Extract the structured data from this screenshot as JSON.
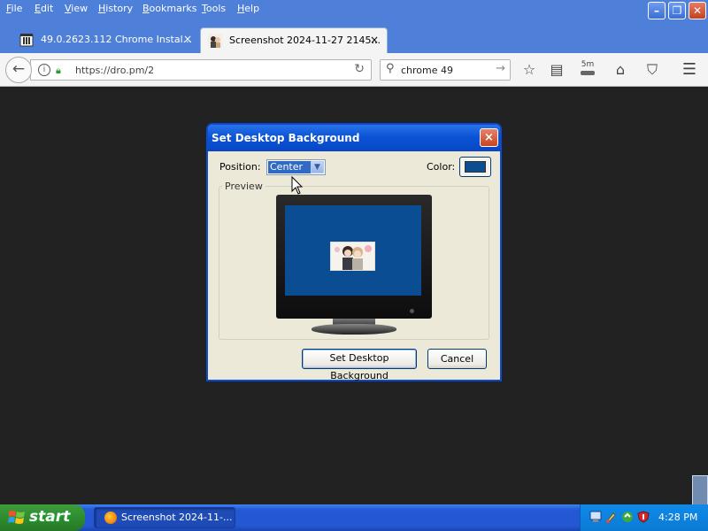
{
  "menubar": {
    "items": [
      "File",
      "Edit",
      "View",
      "History",
      "Bookmarks",
      "Tools",
      "Help"
    ]
  },
  "tabs": [
    {
      "label": "49.0.2623.112 Chrome Instal...",
      "close": "×",
      "active": false
    },
    {
      "label": "Screenshot 2024-11-27 2145...",
      "close": "×",
      "active": true
    }
  ],
  "newtab": "+",
  "navbar": {
    "url": "https://dro.pm/2",
    "search_value": "chrome 49",
    "badge_text": "5m"
  },
  "dialog": {
    "title": "Set Desktop Background",
    "close": "×",
    "position_label": "Position:",
    "position_value": "Center",
    "color_label": "Color:",
    "color_value": "#0a4d91",
    "preview_label": "Preview",
    "set_button": "Set Desktop Background",
    "cancel_button": "Cancel"
  },
  "taskbar": {
    "start_label": "start",
    "task_item": "Screenshot 2024-11-...",
    "clock": "4:28 PM"
  },
  "colors": {
    "xp_blue": "#2458d4",
    "start_green": "#2f8c2f",
    "firefox_tabstrip": "#4f80d9",
    "desktop_preview": "#0b4d92"
  }
}
